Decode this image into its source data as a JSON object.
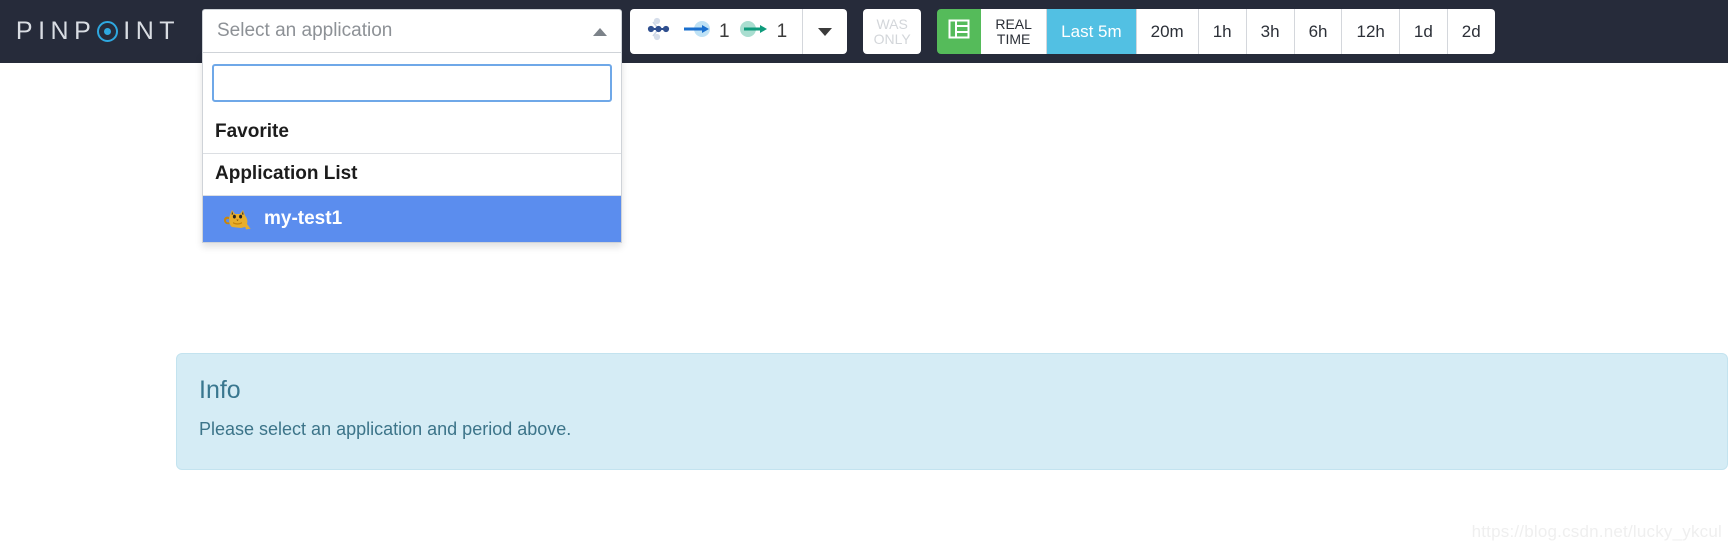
{
  "brand": {
    "part1": "PINP",
    "o_icon": "circle-dot-icon",
    "part2": "INT"
  },
  "app_select": {
    "placeholder": "Select an application",
    "caret_icon": "caret-up-icon",
    "search_value": "",
    "search_placeholder": "",
    "groups": [
      {
        "label": "Favorite"
      },
      {
        "label": "Application List"
      }
    ],
    "items": [
      {
        "label": "my-test1",
        "icon": "tomcat-icon",
        "selected": true
      }
    ]
  },
  "toolbar": {
    "node_icon": "node-graph-icon",
    "inbound_arrow_icon": "arrow-right-blue-icon",
    "inbound_count": "1",
    "outbound_arrow_icon": "arrow-right-green-icon",
    "outbound_count": "1",
    "node_caret_icon": "caret-down-icon",
    "was_only": {
      "line1": "WAS",
      "line2": "ONLY"
    },
    "grid_icon": "grid-table-icon",
    "real_time": {
      "line1": "REAL",
      "line2": "TIME"
    },
    "periods": [
      {
        "label": "Last 5m",
        "active": true
      },
      {
        "label": "20m",
        "active": false
      },
      {
        "label": "1h",
        "active": false
      },
      {
        "label": "3h",
        "active": false
      },
      {
        "label": "6h",
        "active": false
      },
      {
        "label": "12h",
        "active": false
      },
      {
        "label": "1d",
        "active": false
      },
      {
        "label": "2d",
        "active": false
      }
    ]
  },
  "info": {
    "title": "Info",
    "message": "Please select an application and period above."
  },
  "watermark": "https://blog.csdn.net/lucky_ykcul",
  "colors": {
    "navbar_bg": "#262b3a",
    "brand_accent": "#2ea8e0",
    "active_period": "#52c0e3",
    "grid_button": "#55bb5a",
    "selected_item": "#5b8dee",
    "info_bg": "#d5ecf5",
    "info_text": "#3c7489"
  }
}
